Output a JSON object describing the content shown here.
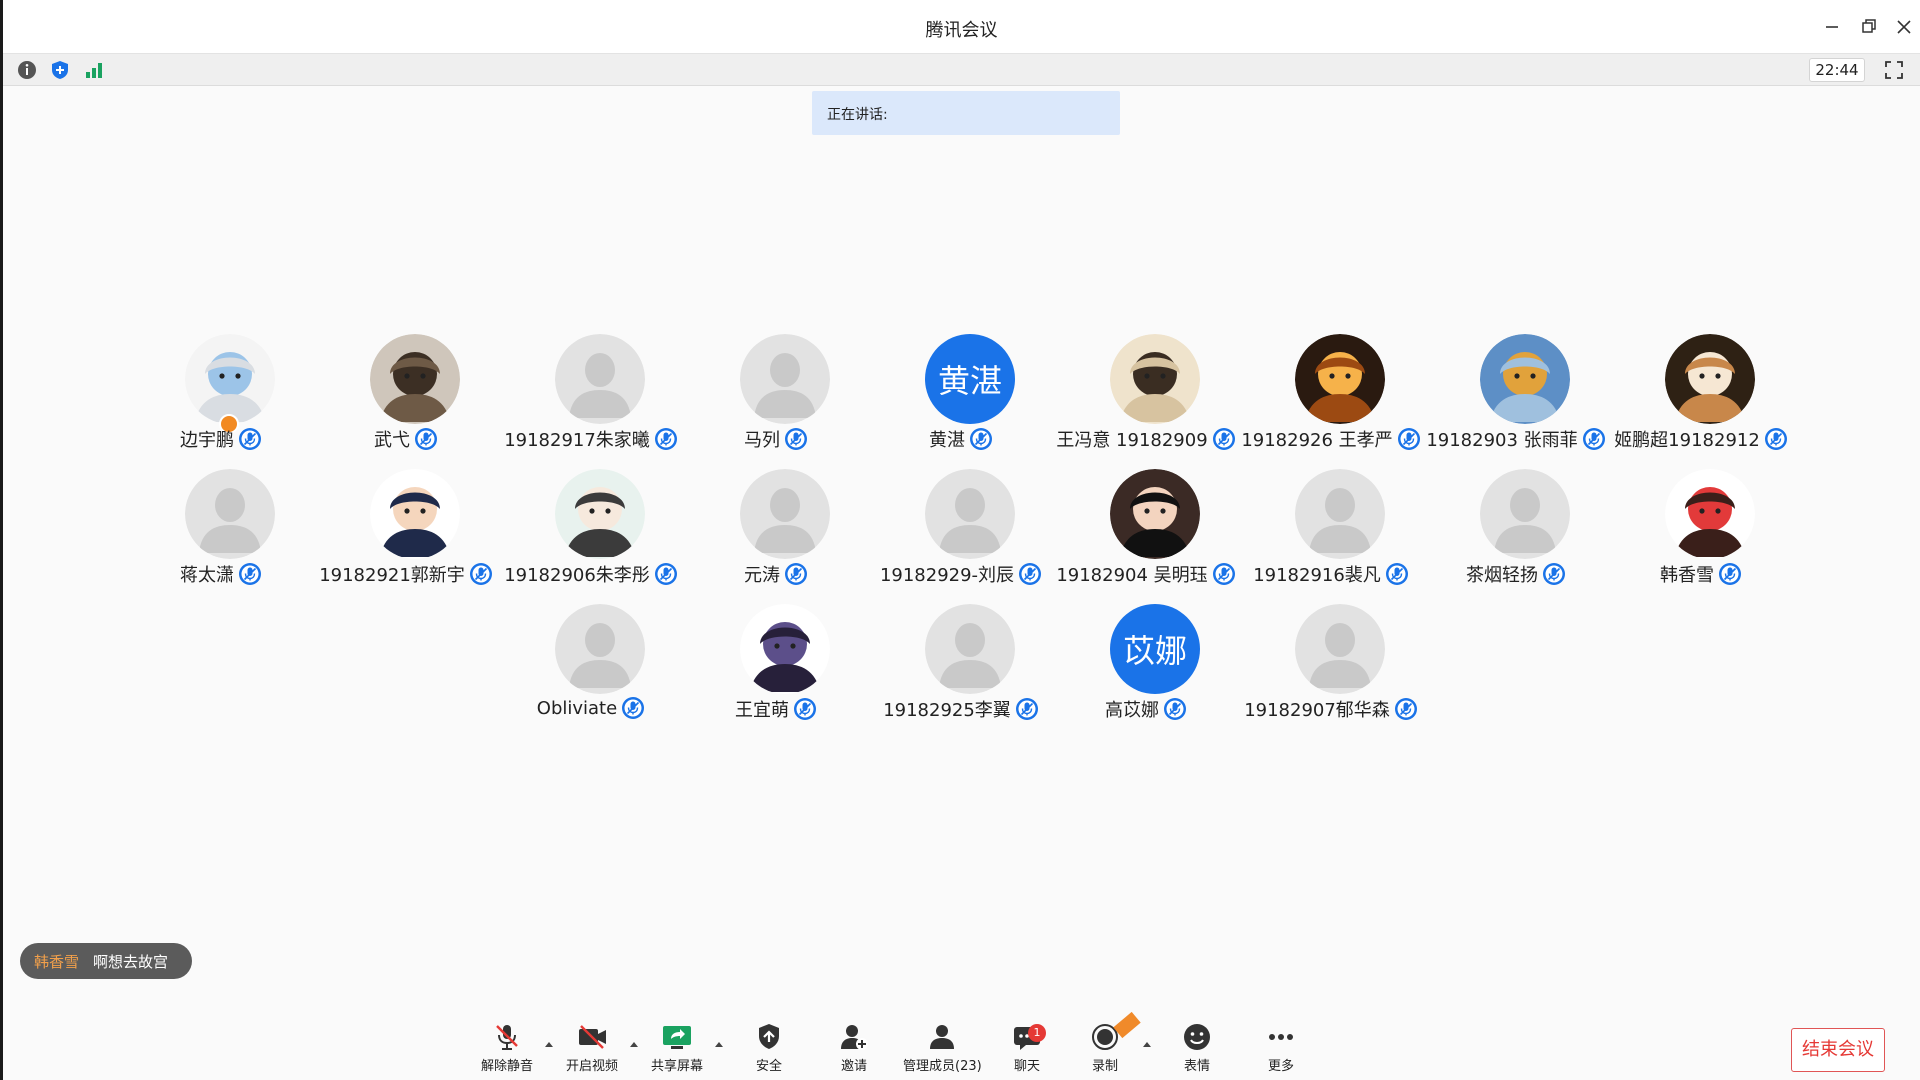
{
  "window": {
    "title": "腾讯会议"
  },
  "infobar": {
    "time": "22:44"
  },
  "speaking": {
    "label": "正在讲话:"
  },
  "participants": [
    {
      "name": "边宇鹏",
      "avatar": "photo-white-cat",
      "host": true
    },
    {
      "name": "武弋",
      "avatar": "photo-otter"
    },
    {
      "name": "19182917朱家曦",
      "avatar": "default"
    },
    {
      "name": "马列",
      "avatar": "default"
    },
    {
      "name": "黄湛",
      "avatar": "text",
      "avatar_text": "黄湛"
    },
    {
      "name": "王冯意 19182909",
      "avatar": "photo-calligraphy"
    },
    {
      "name": "19182926 王孝严",
      "avatar": "photo-sunset-figure"
    },
    {
      "name": "19182903 张雨菲",
      "avatar": "photo-beach"
    },
    {
      "name": "姬鹏超19182912",
      "avatar": "photo-shiba-dog"
    },
    {
      "name": "蒋太潇",
      "avatar": "default"
    },
    {
      "name": "19182921郭新宇",
      "avatar": "cartoon-boy-glasses"
    },
    {
      "name": "19182906朱李彤",
      "avatar": "cartoon-sketch"
    },
    {
      "name": "元涛",
      "avatar": "default"
    },
    {
      "name": "19182929-刘辰",
      "avatar": "default"
    },
    {
      "name": "19182904 吴明珏",
      "avatar": "cartoon-girl-black-hair"
    },
    {
      "name": "19182916裴凡",
      "avatar": "default"
    },
    {
      "name": "茶烟轻扬",
      "avatar": "default"
    },
    {
      "name": "韩香雪",
      "avatar": "cartoon-girl-red"
    },
    {
      "name": "Obliviate",
      "avatar": "default"
    },
    {
      "name": "王宜萌",
      "avatar": "cartoon-boy-card"
    },
    {
      "name": "19182925李翼",
      "avatar": "default"
    },
    {
      "name": "高苡娜",
      "avatar": "text",
      "avatar_text": "苡娜"
    },
    {
      "name": "19182907郁华森",
      "avatar": "default"
    }
  ],
  "toast": {
    "sender": "韩香雪",
    "message": "啊想去故宫"
  },
  "toolbar": {
    "unmute": "解除静音",
    "video": "开启视频",
    "share": "共享屏幕",
    "security": "安全",
    "invite": "邀请",
    "manage": "管理成员(23)",
    "chat": "聊天",
    "chat_badge": "1",
    "record": "录制",
    "reactions": "表情",
    "more": "更多",
    "end": "结束会议"
  },
  "colors": {
    "accent": "#1a73e8",
    "danger": "#e53935",
    "share_green": "#1aa260"
  }
}
